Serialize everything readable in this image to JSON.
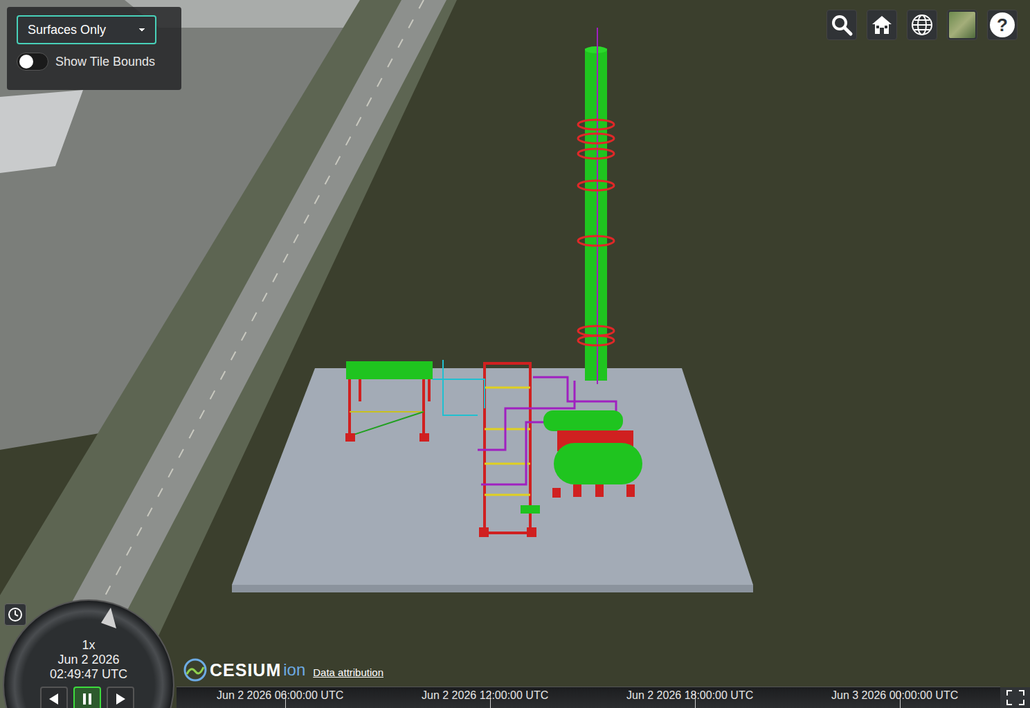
{
  "toolbar": {
    "dropdown": {
      "value": "Surfaces Only"
    },
    "toggle": {
      "label": "Show Tile Bounds",
      "on": false
    }
  },
  "navigation": {
    "help_label": "?"
  },
  "animation": {
    "speed": "1x",
    "date": "Jun 2 2026",
    "time": "02:49:47 UTC",
    "buttons": [
      {
        "kind": "reverse",
        "selected": false
      },
      {
        "kind": "pause",
        "selected": true
      },
      {
        "kind": "play",
        "selected": false
      }
    ]
  },
  "credits": {
    "logo_main": "CESIUM",
    "logo_sub": "ion",
    "link": "Data attribution"
  },
  "timeline": {
    "ticks": [
      "Jun 2 2026 06:00:00 UTC",
      "Jun 2 2026 12:00:00 UTC",
      "Jun 2 2026 18:00:00 UTC",
      "Jun 3 2026 00:00:00 UTC"
    ]
  }
}
